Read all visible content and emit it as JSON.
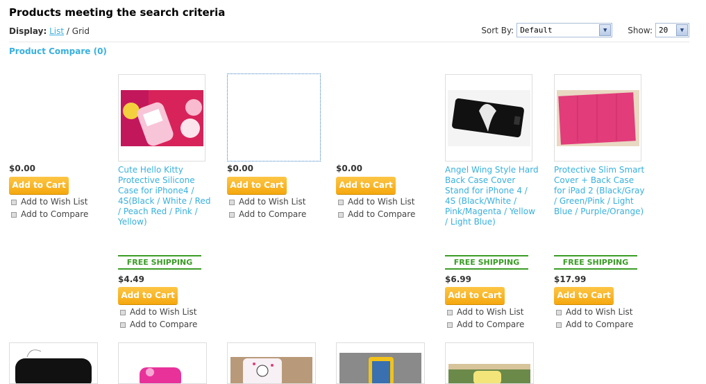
{
  "header": {
    "title": "Products meeting the search criteria",
    "display_label": "Display:",
    "display_list": "List",
    "display_sep": "/",
    "display_grid": "Grid",
    "sort_label": "Sort By:",
    "sort_value": "Default",
    "show_label": "Show:",
    "show_value": "20",
    "compare_link": "Product Compare (0)"
  },
  "actions": {
    "add_to_cart": "Add to Cart",
    "add_to_wishlist": "Add to Wish List",
    "add_to_compare": "Add to Compare",
    "free_shipping": "FREE SHIPPING"
  },
  "row1_empty_prices": [
    "$0.00",
    "$0.00",
    "$0.00"
  ],
  "products": [
    {
      "name": "Cute Hello Kitty Protective Silicone Case for iPhone4 / 4S(Black / White / Red / Peach Red / Pink / Yellow)",
      "price": "$4.49"
    },
    {
      "name": "Angel Wing Style Hard Back Case Cover Stand for iPhone 4 / 4S (Black/White / Pink/Magenta / Yellow / Light Blue)",
      "price": "$6.99"
    },
    {
      "name": "Protective Slim Smart Cover + Back Case for iPad 2 (Black/Gray / Green/Pink / Light Blue / Purple/Orange)",
      "price": "$17.99"
    }
  ],
  "colors": {
    "link": "#38b0de",
    "cart_button": "#f5a80e",
    "free_shipping": "#3a9c25"
  }
}
